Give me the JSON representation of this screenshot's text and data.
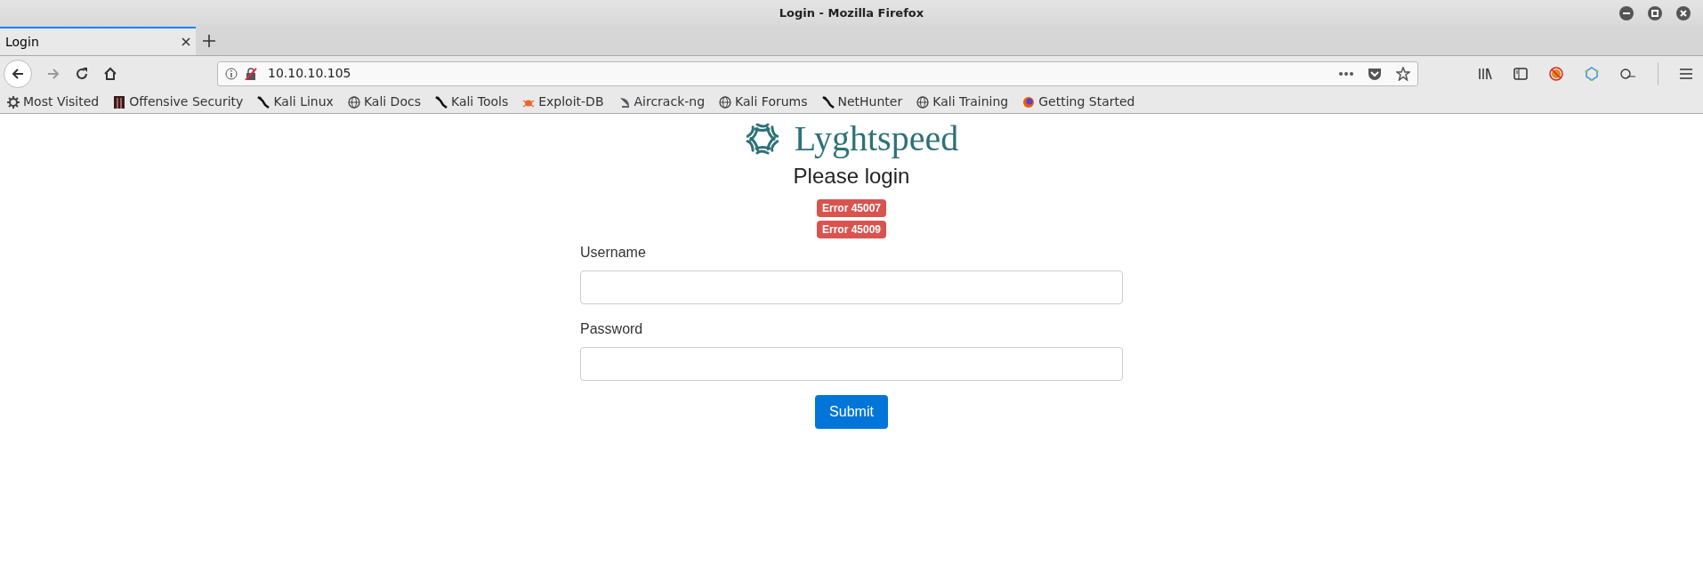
{
  "window": {
    "title": "Login - Mozilla Firefox"
  },
  "tabs": [
    {
      "label": "Login",
      "selected": true
    }
  ],
  "address_bar": {
    "url": "10.10.10.105"
  },
  "bookmarks": [
    {
      "label": "Most Visited",
      "kind": "gear"
    },
    {
      "label": "Offensive Security",
      "kind": "offsec"
    },
    {
      "label": "Kali Linux",
      "kind": "kali"
    },
    {
      "label": "Kali Docs",
      "kind": "globe"
    },
    {
      "label": "Kali Tools",
      "kind": "kali"
    },
    {
      "label": "Exploit-DB",
      "kind": "bug"
    },
    {
      "label": "Aircrack-ng",
      "kind": "dish"
    },
    {
      "label": "Kali Forums",
      "kind": "globe"
    },
    {
      "label": "NetHunter",
      "kind": "kali"
    },
    {
      "label": "Kali Training",
      "kind": "globe"
    },
    {
      "label": "Getting Started",
      "kind": "firefox"
    }
  ],
  "page": {
    "brand": "Lyghtspeed",
    "heading": "Please login",
    "errors": [
      "Error 45007",
      "Error 45009"
    ],
    "fields": [
      {
        "label": "Username"
      },
      {
        "label": "Password"
      }
    ],
    "submit": "Submit"
  }
}
